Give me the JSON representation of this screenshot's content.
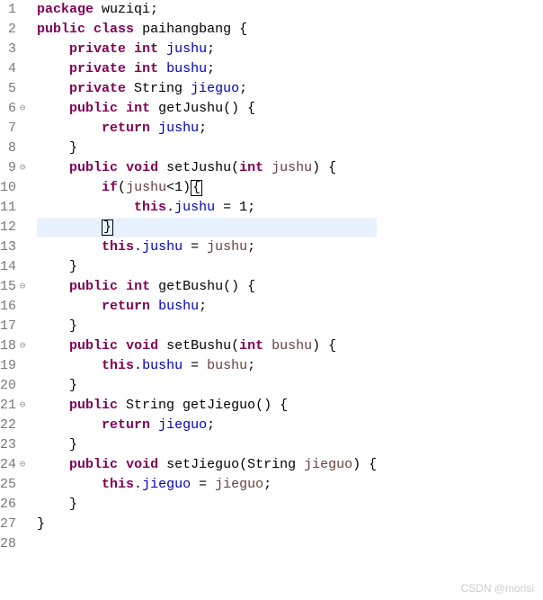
{
  "watermark": "CSDN @morisi",
  "lines": [
    {
      "num": "1",
      "fold": " ",
      "html": "<span class='kw'>package</span><span class='pln'> wuziqi;</span>"
    },
    {
      "num": "2",
      "fold": " ",
      "html": "<span class='kw'>public</span><span class='pln'> </span><span class='kw'>class</span><span class='pln'> paihangbang {</span>"
    },
    {
      "num": "3",
      "fold": " ",
      "html": "<span class='pln'>    </span><span class='kw'>private</span><span class='pln'> </span><span class='kw'>int</span><span class='pln'> </span><span class='fld'>jushu</span><span class='pln'>;</span>"
    },
    {
      "num": "4",
      "fold": " ",
      "html": "<span class='pln'>    </span><span class='kw'>private</span><span class='pln'> </span><span class='kw'>int</span><span class='pln'> </span><span class='fld'>bushu</span><span class='pln'>;</span>"
    },
    {
      "num": "5",
      "fold": " ",
      "html": "<span class='pln'>    </span><span class='kw'>private</span><span class='pln'> String </span><span class='fld'>jieguo</span><span class='pln'>;</span>"
    },
    {
      "num": "6",
      "fold": "⊖",
      "html": "<span class='pln'>    </span><span class='kw'>public</span><span class='pln'> </span><span class='kw'>int</span><span class='pln'> getJushu() {</span>"
    },
    {
      "num": "7",
      "fold": " ",
      "html": "<span class='pln'>        </span><span class='kw'>return</span><span class='pln'> </span><span class='fld'>jushu</span><span class='pln'>;</span>"
    },
    {
      "num": "8",
      "fold": " ",
      "html": "<span class='pln'>    }</span>"
    },
    {
      "num": "9",
      "fold": "⊖",
      "html": "<span class='pln'>    </span><span class='kw'>public</span><span class='pln'> </span><span class='kw'>void</span><span class='pln'> setJushu(</span><span class='kw'>int</span><span class='pln'> </span><span class='prm'>jushu</span><span class='pln'>) {</span>"
    },
    {
      "num": "10",
      "fold": " ",
      "html": "<span class='pln'>        </span><span class='kw'>if</span><span class='pln'>(</span><span class='prm'>jushu</span><span class='pln'>&lt;1)</span><span class='cursor-box'>{</span>"
    },
    {
      "num": "11",
      "fold": " ",
      "html": "<span class='pln'>            </span><span class='kw'>this</span><span class='pln'>.</span><span class='fld'>jushu</span><span class='pln'> = 1;</span>"
    },
    {
      "num": "12",
      "fold": " ",
      "hl": true,
      "html": "<span class='pln'>        </span><span class='cursor-box'>}</span>"
    },
    {
      "num": "13",
      "fold": " ",
      "html": "<span class='pln'>        </span><span class='kw'>this</span><span class='pln'>.</span><span class='fld'>jushu</span><span class='pln'> = </span><span class='prm'>jushu</span><span class='pln'>;</span>"
    },
    {
      "num": "14",
      "fold": " ",
      "html": "<span class='pln'>    }</span>"
    },
    {
      "num": "15",
      "fold": "⊖",
      "html": "<span class='pln'>    </span><span class='kw'>public</span><span class='pln'> </span><span class='kw'>int</span><span class='pln'> getBushu() {</span>"
    },
    {
      "num": "16",
      "fold": " ",
      "html": "<span class='pln'>        </span><span class='kw'>return</span><span class='pln'> </span><span class='fld'>bushu</span><span class='pln'>;</span>"
    },
    {
      "num": "17",
      "fold": " ",
      "html": "<span class='pln'>    }</span>"
    },
    {
      "num": "18",
      "fold": "⊖",
      "html": "<span class='pln'>    </span><span class='kw'>public</span><span class='pln'> </span><span class='kw'>void</span><span class='pln'> setBushu(</span><span class='kw'>int</span><span class='pln'> </span><span class='prm'>bushu</span><span class='pln'>) {</span>"
    },
    {
      "num": "19",
      "fold": " ",
      "html": "<span class='pln'>        </span><span class='kw'>this</span><span class='pln'>.</span><span class='fld'>bushu</span><span class='pln'> = </span><span class='prm'>bushu</span><span class='pln'>;</span>"
    },
    {
      "num": "20",
      "fold": " ",
      "html": "<span class='pln'>    }</span>"
    },
    {
      "num": "21",
      "fold": "⊖",
      "html": "<span class='pln'>    </span><span class='kw'>public</span><span class='pln'> String getJieguo() {</span>"
    },
    {
      "num": "22",
      "fold": " ",
      "html": "<span class='pln'>        </span><span class='kw'>return</span><span class='pln'> </span><span class='fld'>jieguo</span><span class='pln'>;</span>"
    },
    {
      "num": "23",
      "fold": " ",
      "html": "<span class='pln'>    }</span>"
    },
    {
      "num": "24",
      "fold": "⊖",
      "html": "<span class='pln'>    </span><span class='kw'>public</span><span class='pln'> </span><span class='kw'>void</span><span class='pln'> setJieguo(String </span><span class='prm'>jieguo</span><span class='pln'>) {</span>"
    },
    {
      "num": "25",
      "fold": " ",
      "html": "<span class='pln'>        </span><span class='kw'>this</span><span class='pln'>.</span><span class='fld'>jieguo</span><span class='pln'> = </span><span class='prm'>jieguo</span><span class='pln'>;</span>"
    },
    {
      "num": "26",
      "fold": " ",
      "html": "<span class='pln'>    }</span>"
    },
    {
      "num": "27",
      "fold": " ",
      "html": "<span class='pln'>}</span>"
    },
    {
      "num": "28",
      "fold": " ",
      "html": ""
    }
  ]
}
